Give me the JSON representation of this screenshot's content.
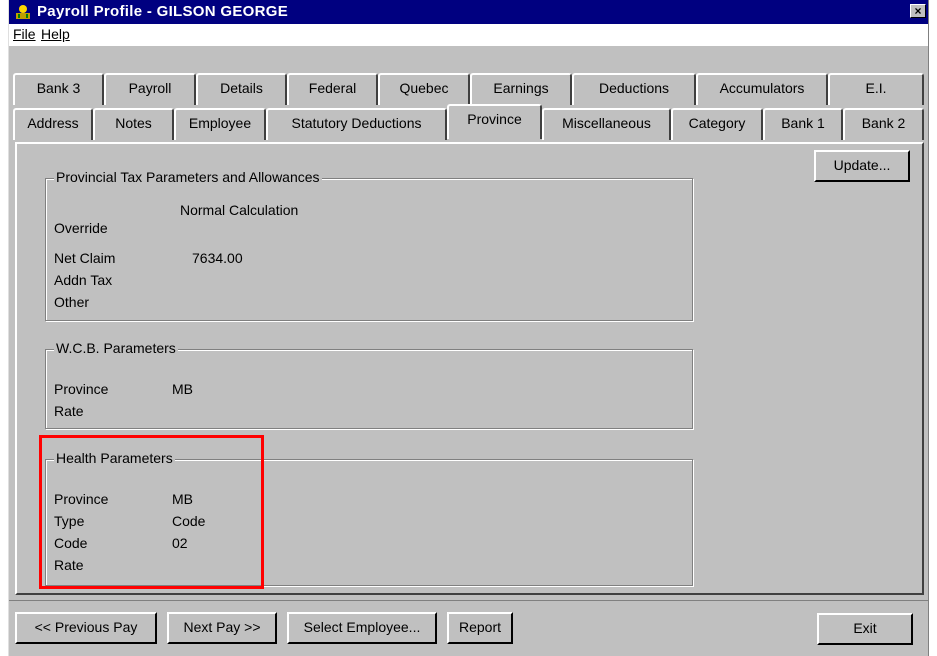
{
  "window": {
    "title": "Payroll Profile - GILSON GEORGE",
    "close_label": "×",
    "app_icon": "payroll-app-icon"
  },
  "menu": {
    "file": "File",
    "help": "Help"
  },
  "tabs_back": [
    "Bank 3",
    "Payroll",
    "Details",
    "Federal",
    "Quebec",
    "Earnings",
    "Deductions",
    "Accumulators",
    "E.I."
  ],
  "tabs_front": [
    "Address",
    "Notes",
    "Employee",
    "Statutory Deductions",
    "Province",
    "Miscellaneous",
    "Category",
    "Bank 1",
    "Bank 2"
  ],
  "active_tab": "Province",
  "update_button": "Update...",
  "provincial": {
    "title": "Provincial Tax Parameters and Allowances",
    "calculation": "Normal Calculation",
    "override_label": "Override",
    "net_claim_label": "Net Claim",
    "net_claim_value": "7634.00",
    "addn_tax_label": "Addn Tax",
    "other_label": "Other"
  },
  "wcb": {
    "title": "W.C.B. Parameters",
    "province_label": "Province",
    "province_value": "MB",
    "rate_label": "Rate"
  },
  "health": {
    "title": "Health Parameters",
    "province_label": "Province",
    "province_value": "MB",
    "type_label": "Type",
    "type_value": "Code",
    "code_label": "Code",
    "code_value": "02",
    "rate_label": "Rate"
  },
  "footer": {
    "previous_pay": "<< Previous Pay",
    "next_pay": "Next Pay >>",
    "select_employee": "Select Employee...",
    "report": "Report",
    "exit": "Exit"
  },
  "colors": {
    "titlebar": "#000080",
    "face": "#c0c0c0",
    "highlight": "#ff0000"
  }
}
